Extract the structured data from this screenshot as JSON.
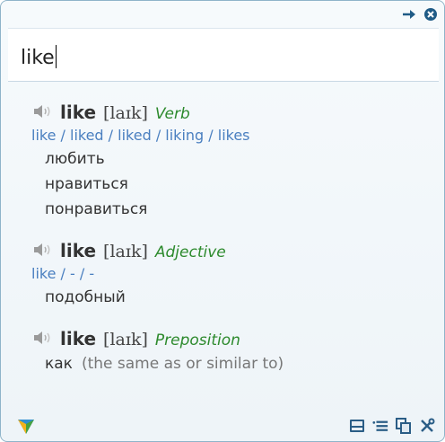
{
  "search": {
    "value": "like"
  },
  "entries": [
    {
      "word": "like",
      "ipa": "[laɪk]",
      "pos": "Verb",
      "forms": "like / liked / liked / liking / likes",
      "translations": [
        "любить",
        "нравиться",
        "понравиться"
      ]
    },
    {
      "word": "like",
      "ipa": "[laɪk]",
      "pos": "Adjective",
      "forms": "like / - / -",
      "translations": [
        "подобный"
      ]
    },
    {
      "word": "like",
      "ipa": "[laɪk]",
      "pos": "Preposition",
      "translation": "как",
      "note": "(the same as or similar to)"
    }
  ],
  "icons": {
    "pin": "pin-icon",
    "close": "close-icon",
    "speaker": "speaker-icon",
    "logo": "app-logo",
    "save": "save-icon",
    "list": "list-icon",
    "copy": "copy-icon",
    "settings": "tools-icon"
  },
  "colors": {
    "accent_blue": "#4a7fc0",
    "pos_green": "#2d8a2d",
    "border": "#8fb4c9"
  }
}
